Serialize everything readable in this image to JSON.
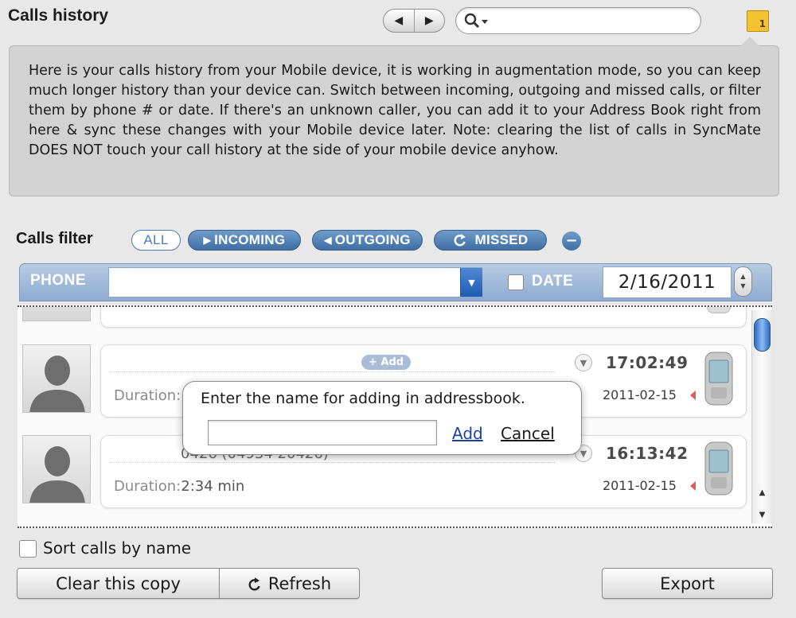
{
  "header": {
    "title": "Calls history",
    "search_placeholder": "",
    "note_badge": "1"
  },
  "info": {
    "text": "Here is your calls history from your Mobile device, it is working in augmentation mode, so you can keep much longer history than your device can. Switch between incoming, outgoing and missed calls, or filter them by phone # or date. If there's an unknown caller, you can add it to your Address Book right from here & sync these changes with your Mobile device later. Note: clearing the list of calls in SyncMate DOES NOT touch your call history at the side of your mobile device anyhow."
  },
  "filter": {
    "label": "Calls filter",
    "all": "ALL",
    "incoming": "INCOMING",
    "outgoing": "OUTGOING",
    "missed": "MISSED",
    "minus": "−",
    "phone_label": "PHONE",
    "date_label": "DATE",
    "date_value": "2/16/2011"
  },
  "calls": [
    {
      "add_label": "+ Add",
      "time": "17:02:49",
      "date": "2011-02-15",
      "duration_label": "Duration:",
      "duration_value": ""
    },
    {
      "number": "0426 (04934 20426)",
      "time": "16:13:42",
      "date": "2011-02-15",
      "duration_label": "Duration:",
      "duration_value": "2:34 min"
    }
  ],
  "popup": {
    "prompt": "Enter the name for adding in addressbook.",
    "add": "Add",
    "cancel": "Cancel"
  },
  "bottom": {
    "sort_label": "Sort calls by name",
    "clear": "Clear this copy",
    "refresh": "Refresh",
    "export": "Export"
  },
  "colors": {
    "accent": "#4e7cb0",
    "missed_marker": "#e05b5b"
  }
}
